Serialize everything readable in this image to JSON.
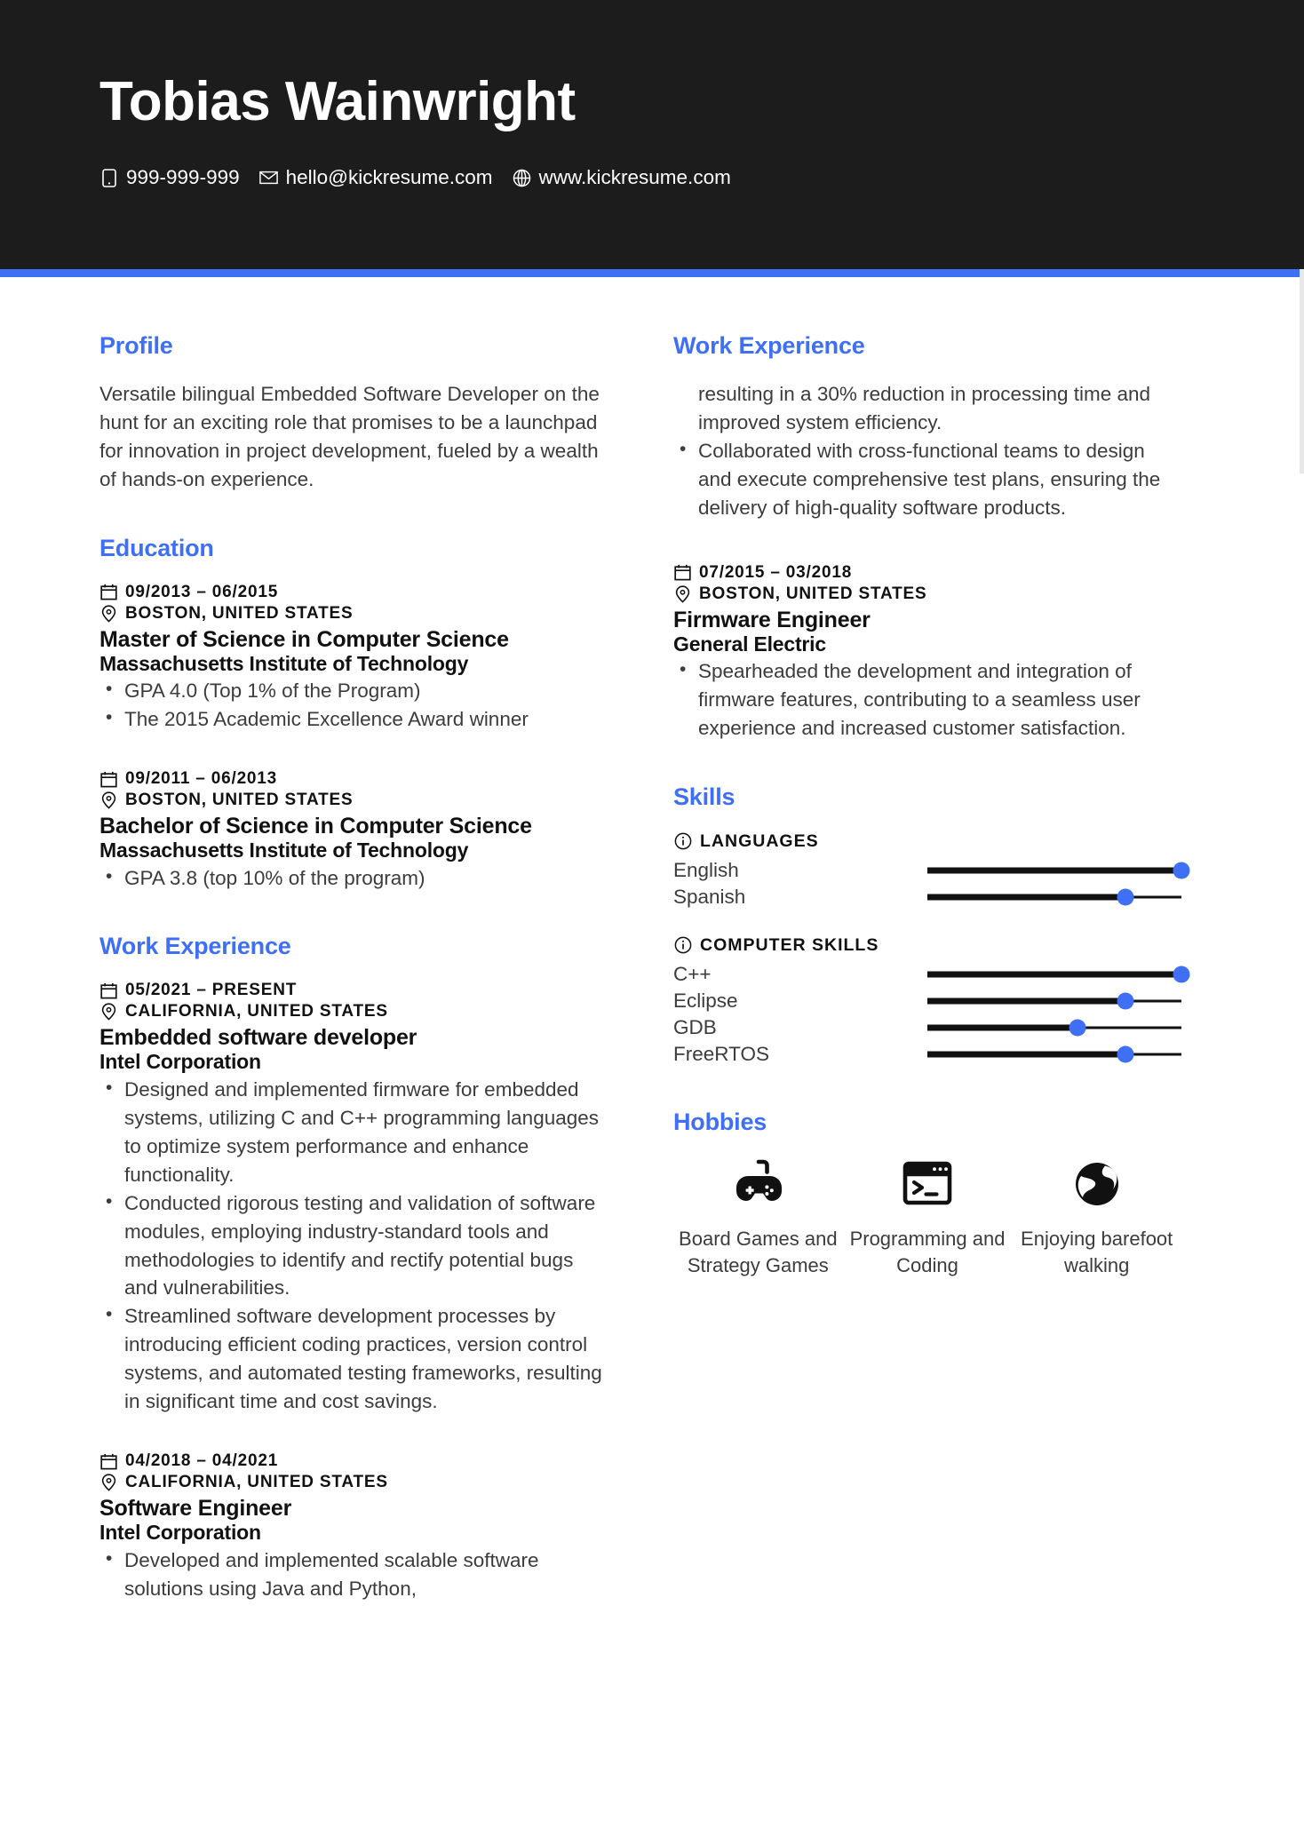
{
  "header": {
    "name": "Tobias Wainwright",
    "contacts": [
      {
        "icon": "phone-icon",
        "value": "999-999-999"
      },
      {
        "icon": "email-icon",
        "value": "hello@kickresume.com"
      },
      {
        "icon": "globe-icon",
        "value": "www.kickresume.com"
      }
    ]
  },
  "colors": {
    "accent": "#3e6ff5",
    "header_bg": "#1c1c1c",
    "body_text": "#3c3c3c",
    "heading_dark": "#111111"
  },
  "left_column": {
    "profile": {
      "title": "Profile",
      "text": "Versatile bilingual Embedded Software Developer on the hunt for an exciting role that promises to be a launchpad for innovation in project development, fueled by a wealth of hands-on experience."
    },
    "education": {
      "title": "Education",
      "entries": [
        {
          "dates": "09/2013 – 06/2015",
          "location": "BOSTON, UNITED STATES",
          "title": "Master of Science in Computer Science",
          "org": "Massachusetts Institute of Technology",
          "bullets": [
            "GPA 4.0 (Top 1% of the Program)",
            "The 2015 Academic Excellence Award winner"
          ]
        },
        {
          "dates": "09/2011 – 06/2013",
          "location": "BOSTON, UNITED STATES",
          "title": "Bachelor of Science in Computer Science",
          "org": "Massachusetts Institute of Technology",
          "bullets": [
            "GPA 3.8 (top 10% of the program)"
          ]
        }
      ]
    },
    "work_experience": {
      "title": "Work Experience",
      "entries": [
        {
          "dates": "05/2021 – PRESENT",
          "location": "CALIFORNIA, UNITED STATES",
          "title": "Embedded software developer",
          "org": "Intel Corporation",
          "bullets": [
            "Designed and implemented firmware for embedded systems, utilizing C and C++ programming languages to optimize system performance and enhance functionality.",
            "Conducted rigorous testing and validation of software modules, employing industry-standard tools and methodologies to identify and rectify potential bugs and vulnerabilities.",
            "Streamlined software development processes by introducing efficient coding practices, version control systems, and automated testing frameworks, resulting in significant time and cost savings."
          ]
        },
        {
          "dates": "04/2018 – 04/2021",
          "location": "CALIFORNIA, UNITED STATES",
          "title": "Software Engineer",
          "org": "Intel Corporation",
          "bullets": [
            "Developed and implemented scalable software solutions using Java and Python,"
          ]
        }
      ]
    }
  },
  "right_column": {
    "work_experience": {
      "title": "Work Experience",
      "continuation": "resulting in a 30% reduction in processing time and improved system efficiency.",
      "continuation_bullets": [
        "Collaborated with cross-functional teams to design and execute comprehensive test plans, ensuring the delivery of high-quality software products."
      ],
      "entries": [
        {
          "dates": "07/2015 – 03/2018",
          "location": "BOSTON, UNITED STATES",
          "title": "Firmware Engineer",
          "org": "General Electric",
          "bullets": [
            "Spearheaded the development and integration of firmware features, contributing to a seamless user experience and increased customer satisfaction."
          ]
        }
      ]
    },
    "skills": {
      "title": "Skills",
      "groups": [
        {
          "icon": "info-icon",
          "name": "LANGUAGES",
          "items": [
            {
              "label": "English",
              "level": 100
            },
            {
              "label": "Spanish",
              "level": 78
            }
          ]
        },
        {
          "icon": "info-icon",
          "name": "COMPUTER SKILLS",
          "items": [
            {
              "label": "C++",
              "level": 100
            },
            {
              "label": "Eclipse",
              "level": 78
            },
            {
              "label": "GDB",
              "level": 59
            },
            {
              "label": "FreeRTOS",
              "level": 78
            }
          ]
        }
      ]
    },
    "hobbies": {
      "title": "Hobbies",
      "items": [
        {
          "icon": "gamepad-icon",
          "label": "Board Games and Strategy Games"
        },
        {
          "icon": "terminal-icon",
          "label": "Programming and Coding"
        },
        {
          "icon": "globe-world-icon",
          "label": "Enjoying barefoot walking"
        }
      ]
    }
  }
}
